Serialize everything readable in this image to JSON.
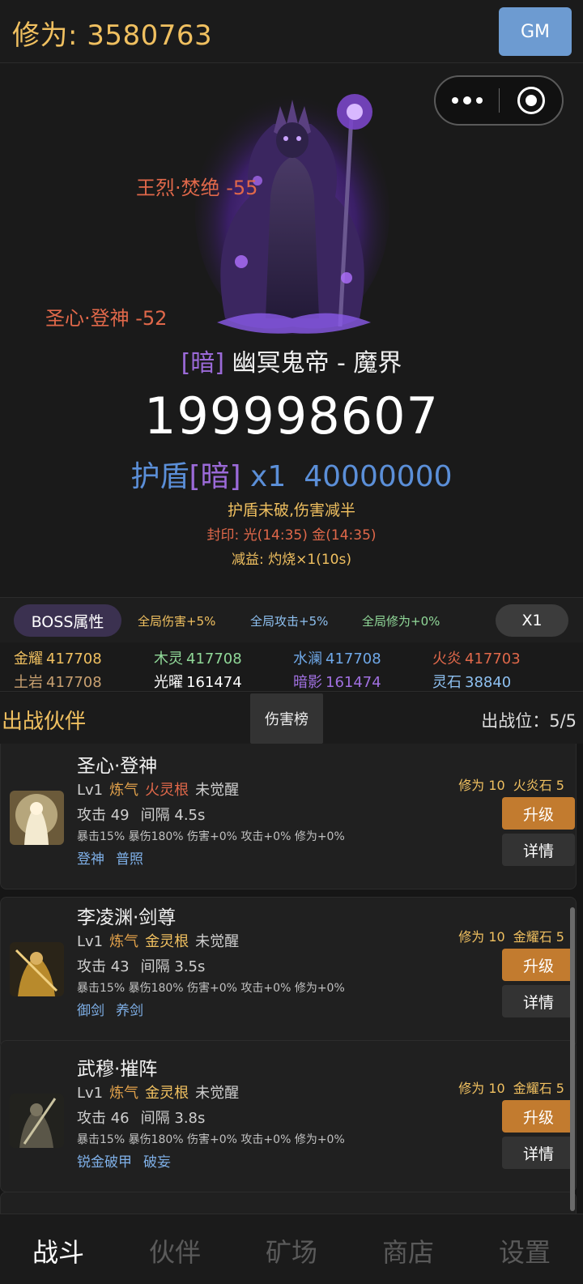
{
  "header": {
    "cultivation": "修为: 3580763",
    "gm_label": "GM"
  },
  "boss": {
    "element": "[暗]",
    "name": " 幽冥鬼帝 - 魔界",
    "hp": "199998607",
    "shield_prefix": "护盾",
    "shield_element": "[暗]",
    "shield_count": " x1",
    "shield_value": "40000000",
    "shield_note": "护盾未破,伤害减半",
    "seal": "封印: 光(14:35) 金(14:35)",
    "debuff": "减益: 灼烧×1(10s)",
    "damage_popups": [
      "王烈·焚绝 -55",
      "圣心·登神 -52"
    ]
  },
  "buffs": {
    "boss_attr_label": "BOSS属性",
    "global_damage": "全局伤害+5%",
    "global_attack": "全局攻击+5%",
    "global_cultivation": "全局修为+0%",
    "speed": "X1"
  },
  "resources": [
    {
      "name": "金耀",
      "value": "417708",
      "color": "#f0c060"
    },
    {
      "name": "木灵",
      "value": "417708",
      "color": "#90d898"
    },
    {
      "name": "水澜",
      "value": "417708",
      "color": "#6fa8e8"
    },
    {
      "name": "火炎",
      "value": "417703",
      "color": "#e0684a"
    },
    {
      "name": "土岩",
      "value": "417708",
      "color": "#c8a070"
    },
    {
      "name": "光曜",
      "value": "161474",
      "color": "#ffffff"
    },
    {
      "name": "暗影",
      "value": "161474",
      "color": "#a070e0"
    },
    {
      "name": "灵石",
      "value": "38840",
      "color": "#8ec0f0"
    }
  ],
  "party": {
    "title": "出战伙伴",
    "rank_label": "伤害榜",
    "slots": "出战位：5/5"
  },
  "partners": [
    {
      "name": "圣心·登神",
      "level": "Lv1",
      "stage": "炼气",
      "root": "火灵根",
      "awake": "未觉醒",
      "attack": "攻击 49",
      "interval": "间隔 4.5s",
      "stats": "暴击15% 暴伤180% 伤害+0% 攻击+0% 修为+0%",
      "skills": [
        "登神",
        "普照"
      ],
      "cost_cult": "修为 10",
      "cost_item": "火炎石 5",
      "upgrade": "升级",
      "detail": "详情"
    },
    {
      "name": "李凌渊·剑尊",
      "level": "Lv1",
      "stage": "炼气",
      "root": "金灵根",
      "awake": "未觉醒",
      "attack": "攻击 43",
      "interval": "间隔 3.5s",
      "stats": "暴击15% 暴伤180% 伤害+0% 攻击+0% 修为+0%",
      "skills": [
        "御剑",
        "养剑"
      ],
      "cost_cult": "修为 10",
      "cost_item": "金耀石 5",
      "upgrade": "升级",
      "detail": "详情"
    },
    {
      "name": "武穆·摧阵",
      "level": "Lv1",
      "stage": "炼气",
      "root": "金灵根",
      "awake": "未觉醒",
      "attack": "攻击 46",
      "interval": "间隔 3.8s",
      "stats": "暴击15% 暴伤180% 伤害+0% 攻击+0% 修为+0%",
      "skills": [
        "锐金破甲",
        "破妄"
      ],
      "cost_cult": "修为 10",
      "cost_item": "金耀石 5",
      "upgrade": "升级",
      "detail": "详情"
    }
  ],
  "nav": [
    "战斗",
    "伙伴",
    "矿场",
    "商店",
    "设置"
  ]
}
